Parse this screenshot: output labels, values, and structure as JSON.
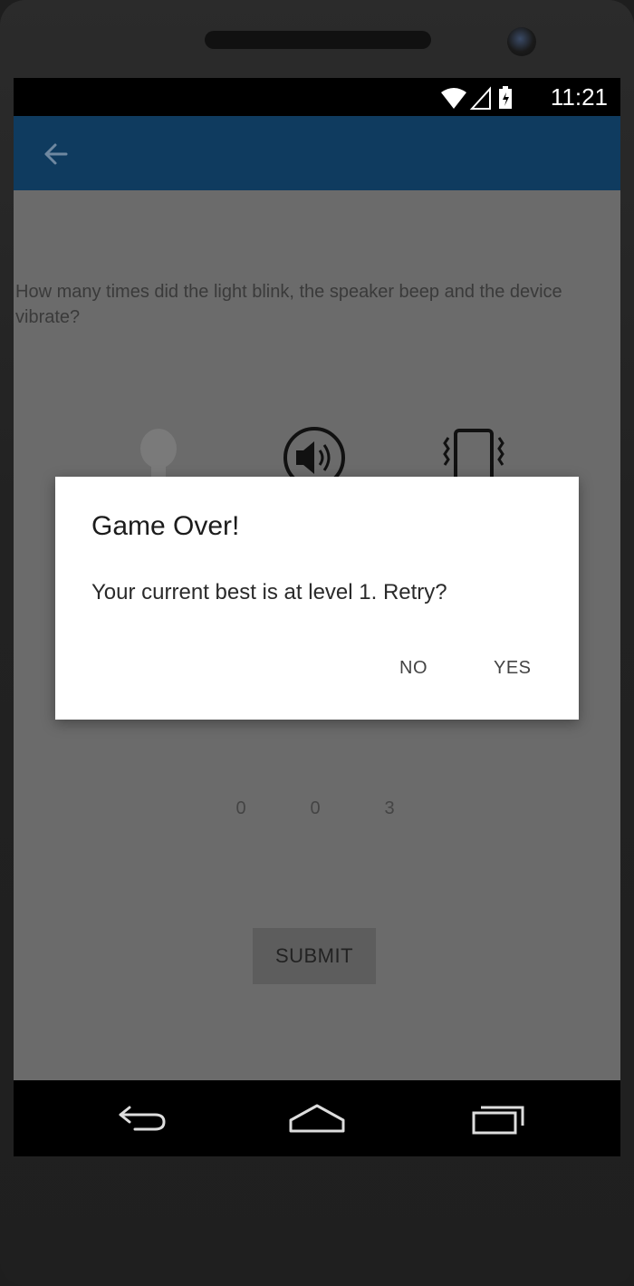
{
  "status_bar": {
    "time": "11:21",
    "icons": [
      "wifi-icon",
      "cell-signal-icon",
      "battery-icon"
    ]
  },
  "app_bar": {
    "back_icon": "arrow-left-icon",
    "color": "#0f3b5f"
  },
  "screen": {
    "question": "How many times did the light blink, the speaker beep and the device vibrate?",
    "indicators": [
      "light-bulb-icon",
      "speaker-icon",
      "vibrate-icon"
    ],
    "counts": [
      "0",
      "0",
      "3"
    ],
    "submit_label": "SUBMIT"
  },
  "dialog": {
    "title": "Game Over!",
    "message": "Your current best is at level 1. Retry?",
    "no_label": "NO",
    "yes_label": "YES"
  },
  "nav_bar": {
    "buttons": [
      "back-nav-icon",
      "home-nav-icon",
      "recents-nav-icon"
    ]
  },
  "colors": {
    "app_bar": "#0f3b5f",
    "scrim_background": "#6b6b6b",
    "dialog": "#ffffff"
  }
}
